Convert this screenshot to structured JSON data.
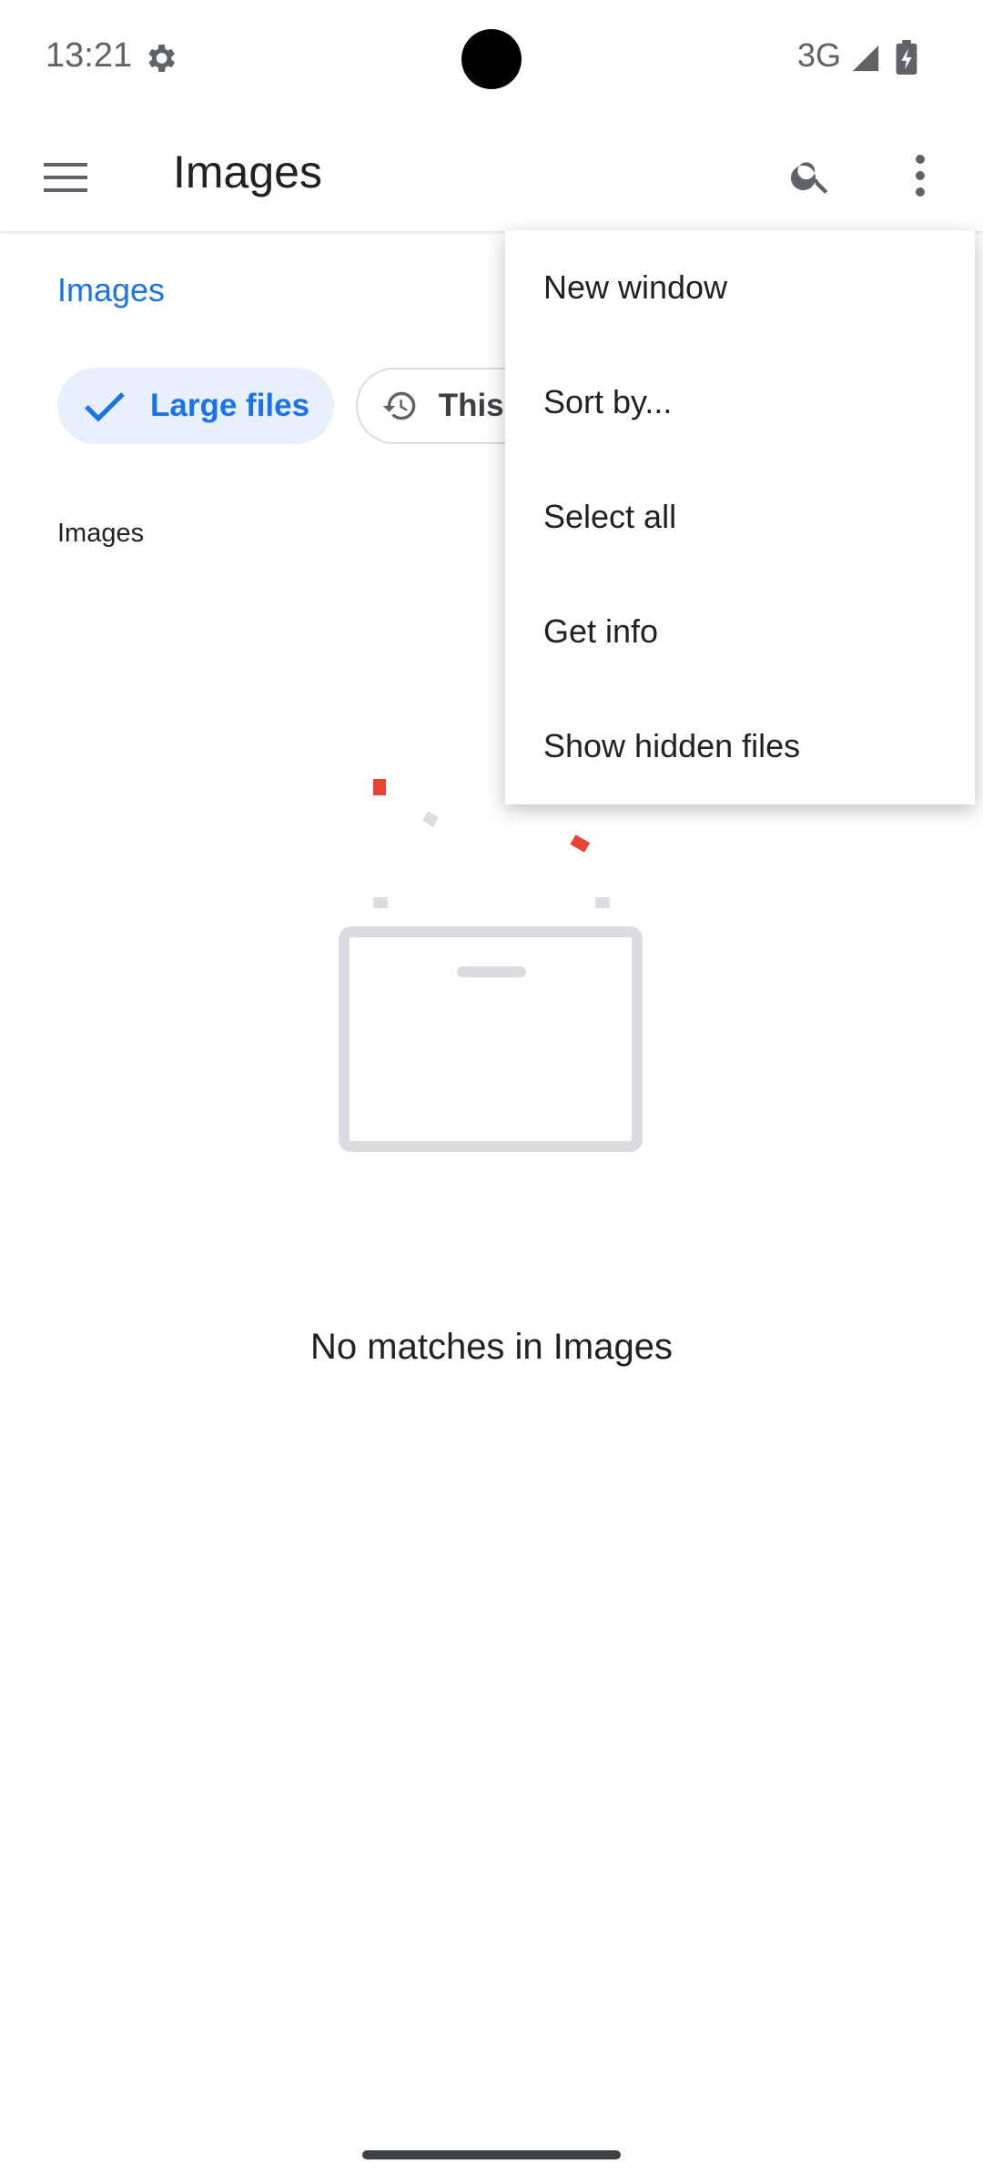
{
  "status_bar": {
    "time": "13:21",
    "network": "3G",
    "settings_icon": "gear-icon",
    "signal_icon": "signal-icon",
    "battery_icon": "battery-charging-icon"
  },
  "app_bar": {
    "title": "Images",
    "menu_icon": "hamburger-menu-icon",
    "search_icon": "search-icon",
    "more_icon": "more-vert-icon"
  },
  "breadcrumb": "Images",
  "chips": [
    {
      "label": "Large files",
      "icon": "check-icon",
      "selected": true
    },
    {
      "label": "This week",
      "icon": "history-icon",
      "selected": false
    }
  ],
  "section_label": "Images",
  "empty_state": {
    "message": "No matches in Images"
  },
  "overflow_menu": {
    "items": [
      {
        "label": "New window"
      },
      {
        "label": "Sort by..."
      },
      {
        "label": "Select all"
      },
      {
        "label": "Get info"
      },
      {
        "label": "Show hidden files"
      }
    ]
  },
  "colors": {
    "accent": "#1a73e8",
    "chip_selected_bg": "#e8f0fe",
    "illustration_gray": "#dadce0",
    "illustration_red": "#ea4335"
  }
}
